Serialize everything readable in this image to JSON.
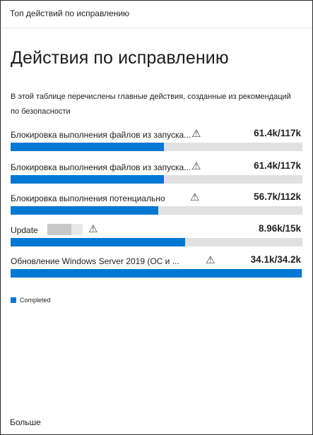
{
  "header": {
    "title": "Топ действий по исправлению"
  },
  "main": {
    "title": "Действия по исправлению",
    "description": "В этой таблице перечислены главные действия, созданные из рекомендаций по безопасности"
  },
  "rows": [
    {
      "label": "Блокировка выполнения файлов из запуска...",
      "value": "61.4k/117k",
      "progress": 0.525
    },
    {
      "label": "Блокировка выполнения файлов из запуска...",
      "value": "61.4k/117k",
      "progress": 0.525
    },
    {
      "label": "Блокировка выполнения потенциально",
      "value": "56.7k/112k",
      "progress": 0.506
    },
    {
      "label": "Update",
      "value": "8.96k/15k",
      "progress": 0.597
    },
    {
      "label": "Обновление Windows Server 2019 (ОС и ...",
      "value": "34.1k/34.2k",
      "progress": 0.997
    }
  ],
  "icons": {
    "row_warning": "warning-triangle-icon"
  },
  "legend": {
    "completed_label": "Completed",
    "completed_color": "#0078d4"
  },
  "footer": {
    "more_label": "Больше"
  }
}
